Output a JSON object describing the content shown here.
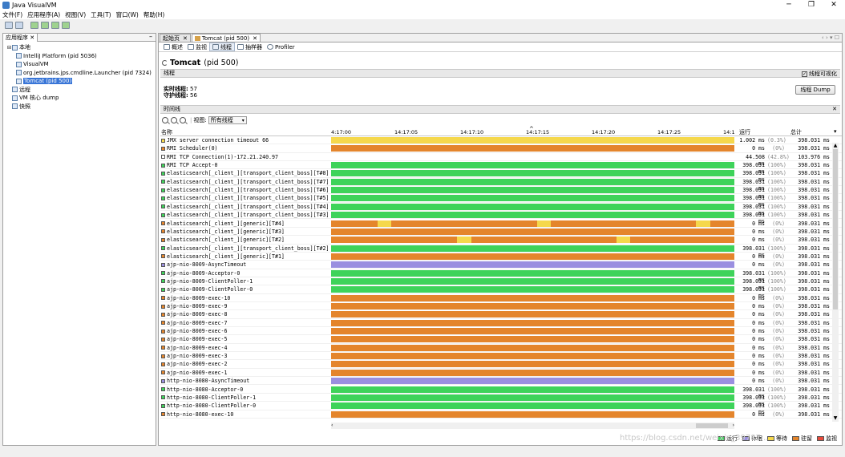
{
  "window": {
    "title": "Java VisualVM"
  },
  "menu": [
    "文件(F)",
    "应用程序(A)",
    "视图(V)",
    "工具(T)",
    "窗口(W)",
    "帮助(H)"
  ],
  "left_panel": {
    "tab_label": "应用程序",
    "tree": [
      {
        "label": "本地",
        "level": 0,
        "toggle": "⊟"
      },
      {
        "label": "IntelliJ Platform (pid 5036)",
        "level": 1
      },
      {
        "label": "VisualVM",
        "level": 1
      },
      {
        "label": "org.jetbrains.jps.cmdline.Launcher (pid 7324)",
        "level": 1
      },
      {
        "label": "Tomcat (pid 500)",
        "level": 1,
        "selected": true
      },
      {
        "label": "远程",
        "level": 0
      },
      {
        "label": "VM 核心 dump",
        "level": 0
      },
      {
        "label": "快照",
        "level": 0
      }
    ]
  },
  "doc_tabs": [
    {
      "label": "起始页",
      "active": false
    },
    {
      "label": "Tomcat (pid 500)",
      "active": true
    }
  ],
  "sub_tabs": [
    {
      "label": "概述",
      "active": false
    },
    {
      "label": "监视",
      "active": false
    },
    {
      "label": "线程",
      "active": true
    },
    {
      "label": "抽样器",
      "active": false
    },
    {
      "label": "Profiler",
      "active": false
    }
  ],
  "page": {
    "title": "Tomcat",
    "pid": "(pid 500)",
    "section_threads": "线程",
    "visualize_label": "线程可视化",
    "live_threads_label": "实时线程:",
    "live_threads_value": "57",
    "daemon_threads_label": "守护线程:",
    "daemon_threads_value": "56",
    "dump_button": "线程 Dump",
    "section_timeline": "时间线",
    "view_label": "视图:",
    "view_select": "所有线程",
    "col_name": "名称",
    "col_run": "运行",
    "col_total": "总计",
    "ticks": [
      "4:17:00",
      "14:17:05",
      "14:17:10",
      "14:17:15",
      "14:17:20",
      "14:17:25",
      "14:1"
    ]
  },
  "colors": {
    "running": "#3ed35a",
    "sleeping": "#9a8fe0",
    "wait": "#f5d84c",
    "park": "#e4852c",
    "monitor": "#e74b3c"
  },
  "legend": [
    {
      "label": "运行",
      "color": "#3ed35a"
    },
    {
      "label": "休眠",
      "color": "#9a8fe0"
    },
    {
      "label": "等待",
      "color": "#f5d84c"
    },
    {
      "label": "驻留",
      "color": "#e4852c"
    },
    {
      "label": "监视",
      "color": "#e74b3c"
    }
  ],
  "threads": [
    {
      "name": "JMX server connection timeout 66",
      "state": "wait",
      "run": "1.002 ms",
      "pct": "(0.3%)",
      "total": "398.031 ms"
    },
    {
      "name": "RMI Scheduler(0)",
      "state": "park",
      "run": "0 ms",
      "pct": "(0%)",
      "total": "398.031 ms"
    },
    {
      "name": "RMI TCP Connection(1)-172.21.240.97",
      "state": "none",
      "run": "44.508 ms",
      "pct": "(42.8%)",
      "total": "103.976 ms"
    },
    {
      "name": "RMI TCP Accept-0",
      "state": "running",
      "run": "398.031 ms",
      "pct": "(100%)",
      "total": "398.031 ms"
    },
    {
      "name": "elasticsearch[_client_][transport_client_boss][T#8]",
      "state": "running",
      "run": "398.031 ms",
      "pct": "(100%)",
      "total": "398.031 ms"
    },
    {
      "name": "elasticsearch[_client_][transport_client_boss][T#7]",
      "state": "running",
      "run": "398.031 ms",
      "pct": "(100%)",
      "total": "398.031 ms"
    },
    {
      "name": "elasticsearch[_client_][transport_client_boss][T#6]",
      "state": "running",
      "run": "398.031 ms",
      "pct": "(100%)",
      "total": "398.031 ms"
    },
    {
      "name": "elasticsearch[_client_][transport_client_boss][T#5]",
      "state": "running",
      "run": "398.031 ms",
      "pct": "(100%)",
      "total": "398.031 ms"
    },
    {
      "name": "elasticsearch[_client_][transport_client_boss][T#4]",
      "state": "running",
      "run": "398.031 ms",
      "pct": "(100%)",
      "total": "398.031 ms"
    },
    {
      "name": "elasticsearch[_client_][transport_client_boss][T#3]",
      "state": "running",
      "run": "398.031 ms",
      "pct": "(100%)",
      "total": "398.031 ms"
    },
    {
      "name": "elasticsearch[_client_][generic][T#4]",
      "state": "park",
      "run": "0 ms",
      "pct": "(0%)",
      "total": "398.031 ms",
      "waits": [
        [
          0.115,
          0.15
        ],
        [
          0.51,
          0.545
        ],
        [
          0.905,
          0.94
        ]
      ]
    },
    {
      "name": "elasticsearch[_client_][generic][T#3]",
      "state": "park",
      "run": "0 ms",
      "pct": "(0%)",
      "total": "398.031 ms"
    },
    {
      "name": "elasticsearch[_client_][generic][T#2]",
      "state": "park",
      "run": "0 ms",
      "pct": "(0%)",
      "total": "398.031 ms",
      "waits": [
        [
          0.313,
          0.347
        ],
        [
          0.707,
          0.742
        ]
      ]
    },
    {
      "name": "elasticsearch[_client_][transport_client_boss][T#2]",
      "state": "running",
      "run": "398.031 ms",
      "pct": "(100%)",
      "total": "398.031 ms"
    },
    {
      "name": "elasticsearch[_client_][generic][T#1]",
      "state": "park",
      "run": "0 ms",
      "pct": "(0%)",
      "total": "398.031 ms"
    },
    {
      "name": "ajp-nio-8009-AsyncTimeout",
      "state": "sleeping",
      "run": "0 ms",
      "pct": "(0%)",
      "total": "398.031 ms"
    },
    {
      "name": "ajp-nio-8009-Acceptor-0",
      "state": "running",
      "run": "398.031 ms",
      "pct": "(100%)",
      "total": "398.031 ms"
    },
    {
      "name": "ajp-nio-8009-ClientPoller-1",
      "state": "running",
      "run": "398.031 ms",
      "pct": "(100%)",
      "total": "398.031 ms"
    },
    {
      "name": "ajp-nio-8009-ClientPoller-0",
      "state": "running",
      "run": "398.031 ms",
      "pct": "(100%)",
      "total": "398.031 ms"
    },
    {
      "name": "ajp-nio-8009-exec-10",
      "state": "park",
      "run": "0 ms",
      "pct": "(0%)",
      "total": "398.031 ms"
    },
    {
      "name": "ajp-nio-8009-exec-9",
      "state": "park",
      "run": "0 ms",
      "pct": "(0%)",
      "total": "398.031 ms"
    },
    {
      "name": "ajp-nio-8009-exec-8",
      "state": "park",
      "run": "0 ms",
      "pct": "(0%)",
      "total": "398.031 ms"
    },
    {
      "name": "ajp-nio-8009-exec-7",
      "state": "park",
      "run": "0 ms",
      "pct": "(0%)",
      "total": "398.031 ms"
    },
    {
      "name": "ajp-nio-8009-exec-6",
      "state": "park",
      "run": "0 ms",
      "pct": "(0%)",
      "total": "398.031 ms"
    },
    {
      "name": "ajp-nio-8009-exec-5",
      "state": "park",
      "run": "0 ms",
      "pct": "(0%)",
      "total": "398.031 ms"
    },
    {
      "name": "ajp-nio-8009-exec-4",
      "state": "park",
      "run": "0 ms",
      "pct": "(0%)",
      "total": "398.031 ms"
    },
    {
      "name": "ajp-nio-8009-exec-3",
      "state": "park",
      "run": "0 ms",
      "pct": "(0%)",
      "total": "398.031 ms"
    },
    {
      "name": "ajp-nio-8009-exec-2",
      "state": "park",
      "run": "0 ms",
      "pct": "(0%)",
      "total": "398.031 ms"
    },
    {
      "name": "ajp-nio-8009-exec-1",
      "state": "park",
      "run": "0 ms",
      "pct": "(0%)",
      "total": "398.031 ms"
    },
    {
      "name": "http-nio-8080-AsyncTimeout",
      "state": "sleeping",
      "run": "0 ms",
      "pct": "(0%)",
      "total": "398.031 ms"
    },
    {
      "name": "http-nio-8080-Acceptor-0",
      "state": "running",
      "run": "398.031 ms",
      "pct": "(100%)",
      "total": "398.031 ms"
    },
    {
      "name": "http-nio-8080-ClientPoller-1",
      "state": "running",
      "run": "398.031 ms",
      "pct": "(100%)",
      "total": "398.031 ms"
    },
    {
      "name": "http-nio-8080-ClientPoller-0",
      "state": "running",
      "run": "398.031 ms",
      "pct": "(100%)",
      "total": "398.031 ms"
    },
    {
      "name": "http-nio-8080-exec-10",
      "state": "park",
      "run": "0 ms",
      "pct": "(0%)",
      "total": "398.031 ms"
    }
  ],
  "watermark": "https://blog.csdn.net/weixin_39787..."
}
